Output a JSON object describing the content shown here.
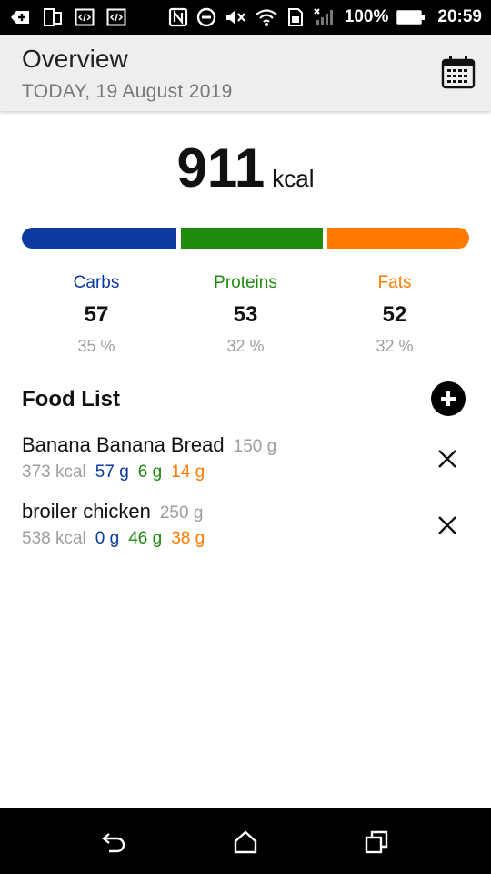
{
  "status_bar": {
    "battery": "100%",
    "time": "20:59",
    "icons": [
      "add-box-icon",
      "device-icon",
      "code-icon",
      "code-icon",
      "nfc-icon",
      "do-not-disturb-icon",
      "mute-icon",
      "wifi-icon",
      "sim-icon",
      "signal-icon",
      "battery-icon"
    ]
  },
  "header": {
    "title": "Overview",
    "date": "TODAY, 19 August 2019",
    "calendar_icon": "calendar-icon"
  },
  "summary": {
    "total_value": "911",
    "total_unit": "kcal"
  },
  "macros": [
    {
      "name": "Carbs",
      "grams": "57",
      "percent": "35 %",
      "fraction": 0.35,
      "color": "#0b3aa0"
    },
    {
      "name": "Proteins",
      "grams": "53",
      "percent": "32 %",
      "fraction": 0.32,
      "color": "#1e8a0e"
    },
    {
      "name": "Fats",
      "grams": "52",
      "percent": "32 %",
      "fraction": 0.32,
      "color": "#ff7a00"
    }
  ],
  "food_list": {
    "title": "Food List",
    "add_icon": "add-circle-icon",
    "items": [
      {
        "name": "Banana Banana Bread",
        "weight": "150 g",
        "kcal": "373 kcal",
        "carbs": "57 g",
        "proteins": "6 g",
        "fats": "14 g"
      },
      {
        "name": "broiler chicken",
        "weight": "250 g",
        "kcal": "538 kcal",
        "carbs": "0 g",
        "proteins": "46 g",
        "fats": "38 g"
      }
    ]
  },
  "nav_bar": {
    "icons": [
      "back-icon",
      "home-icon",
      "recents-icon"
    ]
  }
}
